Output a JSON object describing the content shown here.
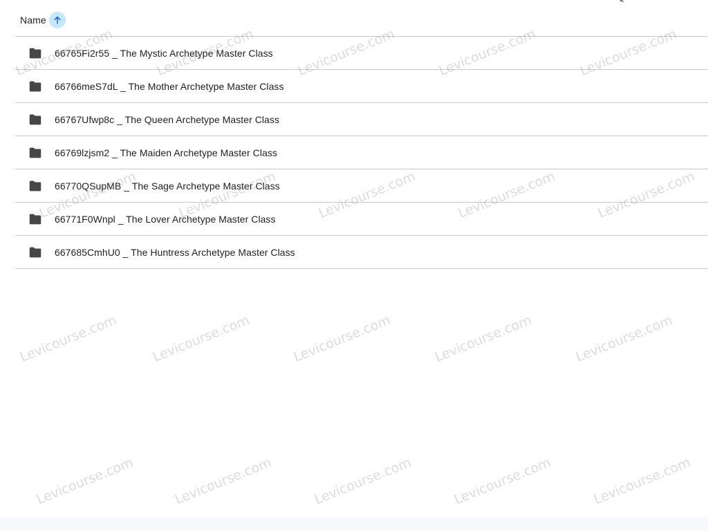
{
  "header": {
    "name_label": "Name",
    "sort_icon": "arrow-upward-icon",
    "sort_direction": "ascending"
  },
  "folders": [
    {
      "name": "66765Fi2r55 _ The Mystic Archetype Master Class",
      "icon": "folder-icon"
    },
    {
      "name": "66766meS7dL _ The Mother Archetype Master Class",
      "icon": "folder-icon"
    },
    {
      "name": "66767Ufwp8c _ The Queen Archetype Master Class",
      "icon": "folder-icon"
    },
    {
      "name": "66769lzjsm2 _ The Maiden Archetype Master Class",
      "icon": "folder-icon"
    },
    {
      "name": "66770QSupMB _ The Sage Archetype Master Class",
      "icon": "folder-icon"
    },
    {
      "name": "66771F0Wnpl _ The Lover Archetype Master Class",
      "icon": "folder-icon"
    },
    {
      "name": "667685CmhU0 _ The Huntress Archetype Master Class",
      "icon": "folder-icon"
    }
  ],
  "watermark": {
    "text": "Levicourse.com"
  },
  "colors": {
    "sort_badge": "#c2e7ff",
    "sort_arrow": "#0b57d0",
    "folder": "#444746",
    "divider": "#c7c7c7"
  }
}
